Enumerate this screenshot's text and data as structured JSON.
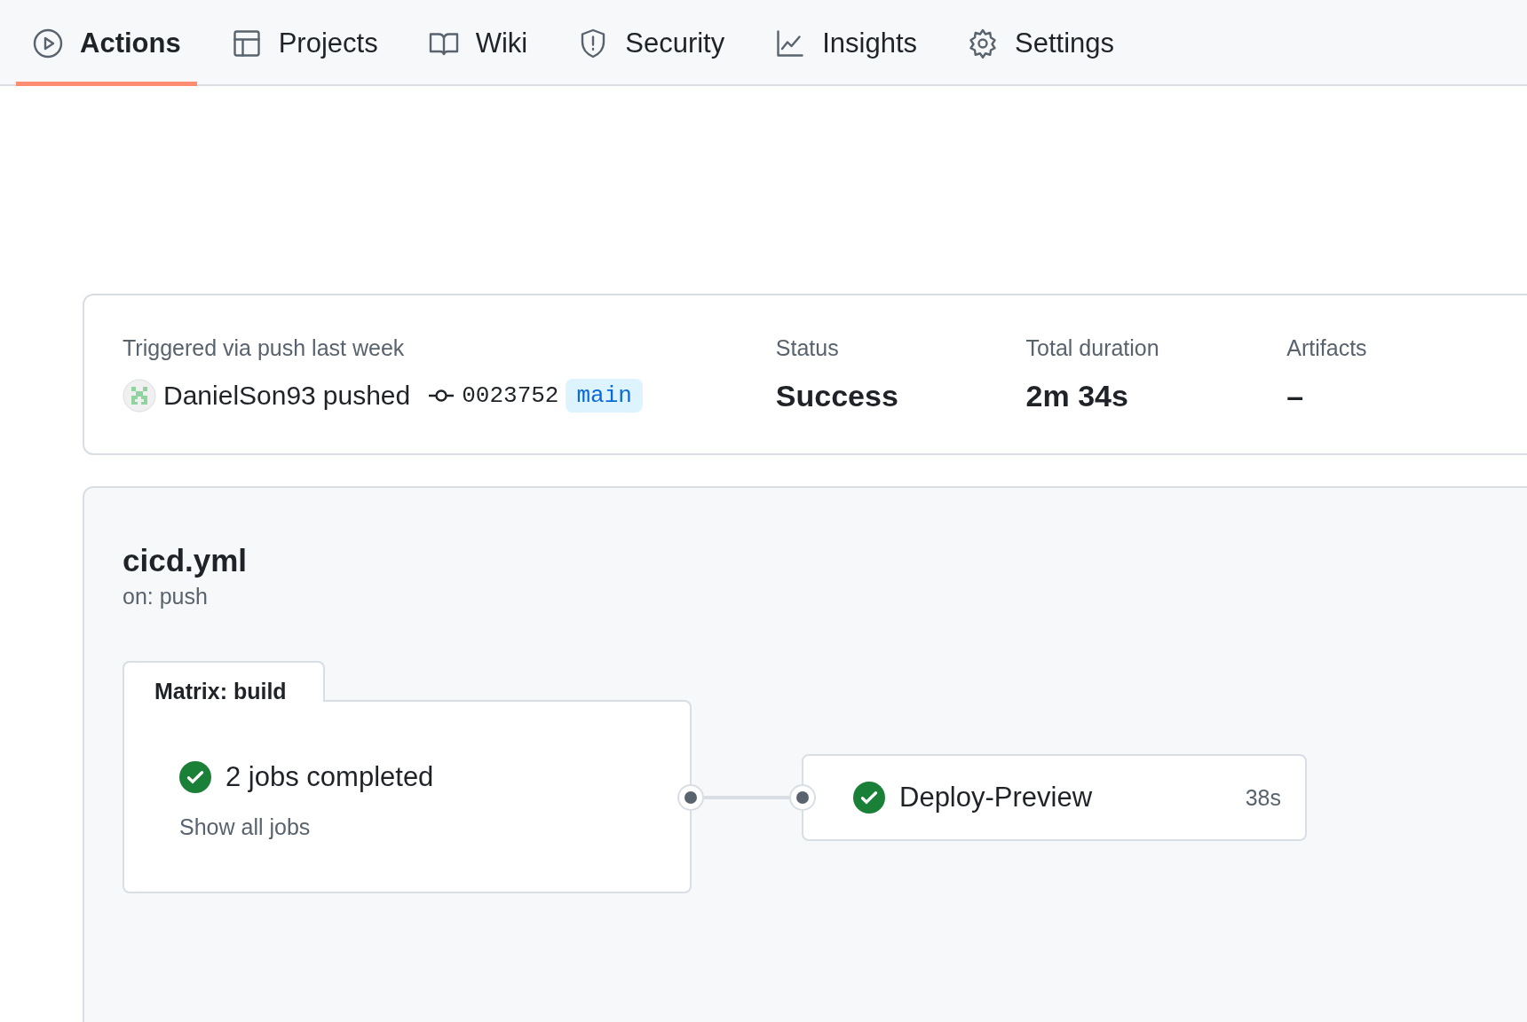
{
  "tabs": [
    {
      "label": "Actions",
      "kind": "play",
      "selected": true
    },
    {
      "label": "Projects",
      "kind": "table",
      "selected": false
    },
    {
      "label": "Wiki",
      "kind": "book",
      "selected": false
    },
    {
      "label": "Security",
      "kind": "shield",
      "selected": false
    },
    {
      "label": "Insights",
      "kind": "graph",
      "selected": false
    },
    {
      "label": "Settings",
      "kind": "gear",
      "selected": false
    }
  ],
  "summary": {
    "trigger": "Triggered via push last week",
    "user": "DanielSon93",
    "action": "pushed",
    "commit": "0023752",
    "branch": "main",
    "fields": [
      {
        "label": "Status",
        "value": "Success"
      },
      {
        "label": "Total duration",
        "value": "2m 34s"
      },
      {
        "label": "Artifacts",
        "value": "–"
      }
    ]
  },
  "workflow": {
    "name": "cicd.yml",
    "event": "on: push",
    "matrix": {
      "title": "Matrix: build",
      "kind": "success",
      "summary": "2 jobs completed",
      "link": "Show all jobs"
    },
    "jobs": [
      {
        "name": "Deploy-Preview",
        "kind": "success",
        "duration": "38s"
      }
    ]
  }
}
